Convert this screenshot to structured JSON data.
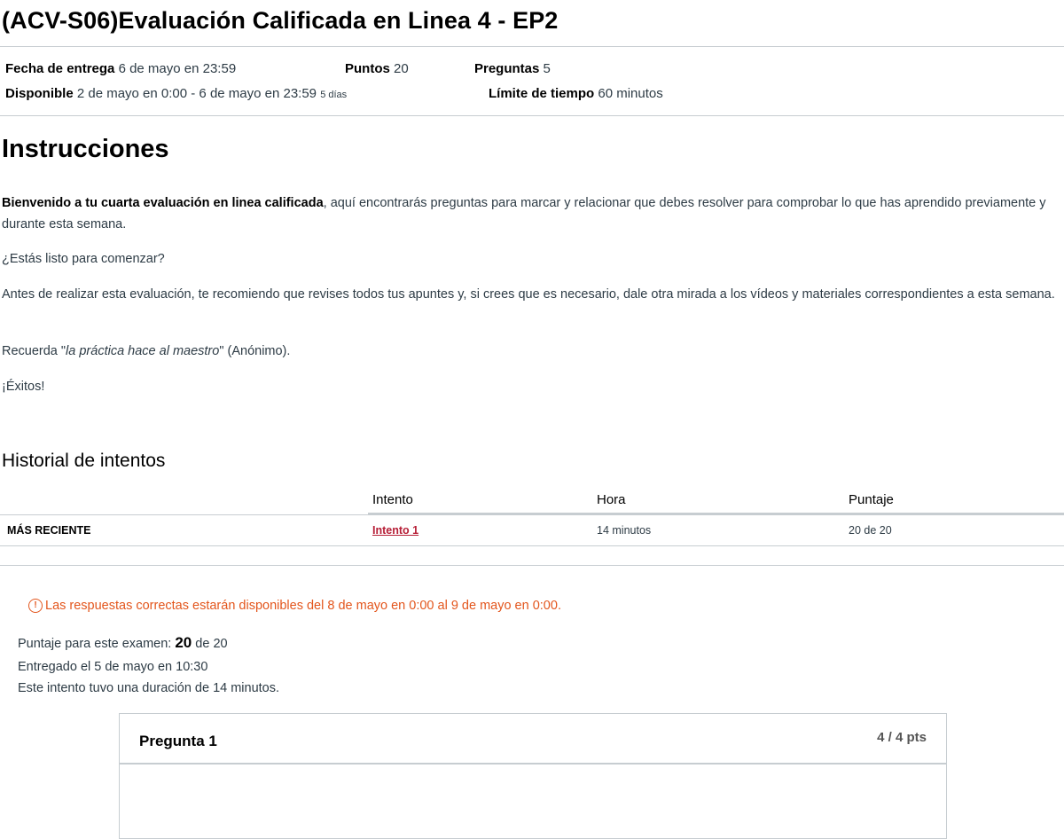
{
  "header": {
    "title": "(ACV-S06)Evaluación Calificada en Linea 4 - EP2"
  },
  "meta": {
    "due_label": "Fecha de entrega",
    "due_value": "6 de mayo en 23:59",
    "points_label": "Puntos",
    "points_value": "20",
    "questions_label": "Preguntas",
    "questions_value": "5",
    "available_label": "Disponible",
    "available_value": "2 de mayo en 0:00 - 6 de mayo en 23:59",
    "available_days": "5 días",
    "time_limit_label": "Límite de tiempo",
    "time_limit_value": "60 minutos"
  },
  "instructions": {
    "title": "Instrucciones",
    "p1_bold": "Bienvenido a tu cuarta evaluación en linea calificada",
    "p1_rest": ", aquí encontrarás preguntas para marcar y relacionar que debes resolver para comprobar lo que has aprendido previamente y durante esta semana.",
    "p2": "¿Estás listo para comenzar?",
    "p3": "Antes de realizar esta evaluación, te recomiendo que revises todos tus apuntes y, si crees que es necesario, dale otra mirada a los vídeos y materiales correspondientes a esta semana.",
    "p4_pre": "Recuerda \"",
    "p4_italic": "la práctica hace al maestro",
    "p4_post": "\" (Anónimo).",
    "p5": "¡Éxitos!"
  },
  "history": {
    "title": "Historial de intentos",
    "columns": [
      "Intento",
      "Hora",
      "Puntaje"
    ],
    "rows": [
      {
        "label": "MÁS RECIENTE",
        "attempt": "Intento 1",
        "time": "14 minutos",
        "score": "20 de 20"
      }
    ]
  },
  "notice": {
    "icon": "warning-circle-icon",
    "icon_glyph": "!",
    "text": "Las respuestas correctas estarán disponibles del 8 de mayo en 0:00 al 9 de mayo en 0:00.",
    "color": "#e3561d"
  },
  "summary": {
    "score_prefix": "Puntaje para este examen: ",
    "score_value": "20",
    "score_suffix": " de 20",
    "submitted": "Entregado el 5 de mayo en 10:30",
    "duration": "Este intento tuvo una duración de 14 minutos."
  },
  "question": {
    "title": "Pregunta 1",
    "points": "4 / 4 pts"
  },
  "colors": {
    "link": "#b61e36",
    "border": "#c7cdd1"
  }
}
